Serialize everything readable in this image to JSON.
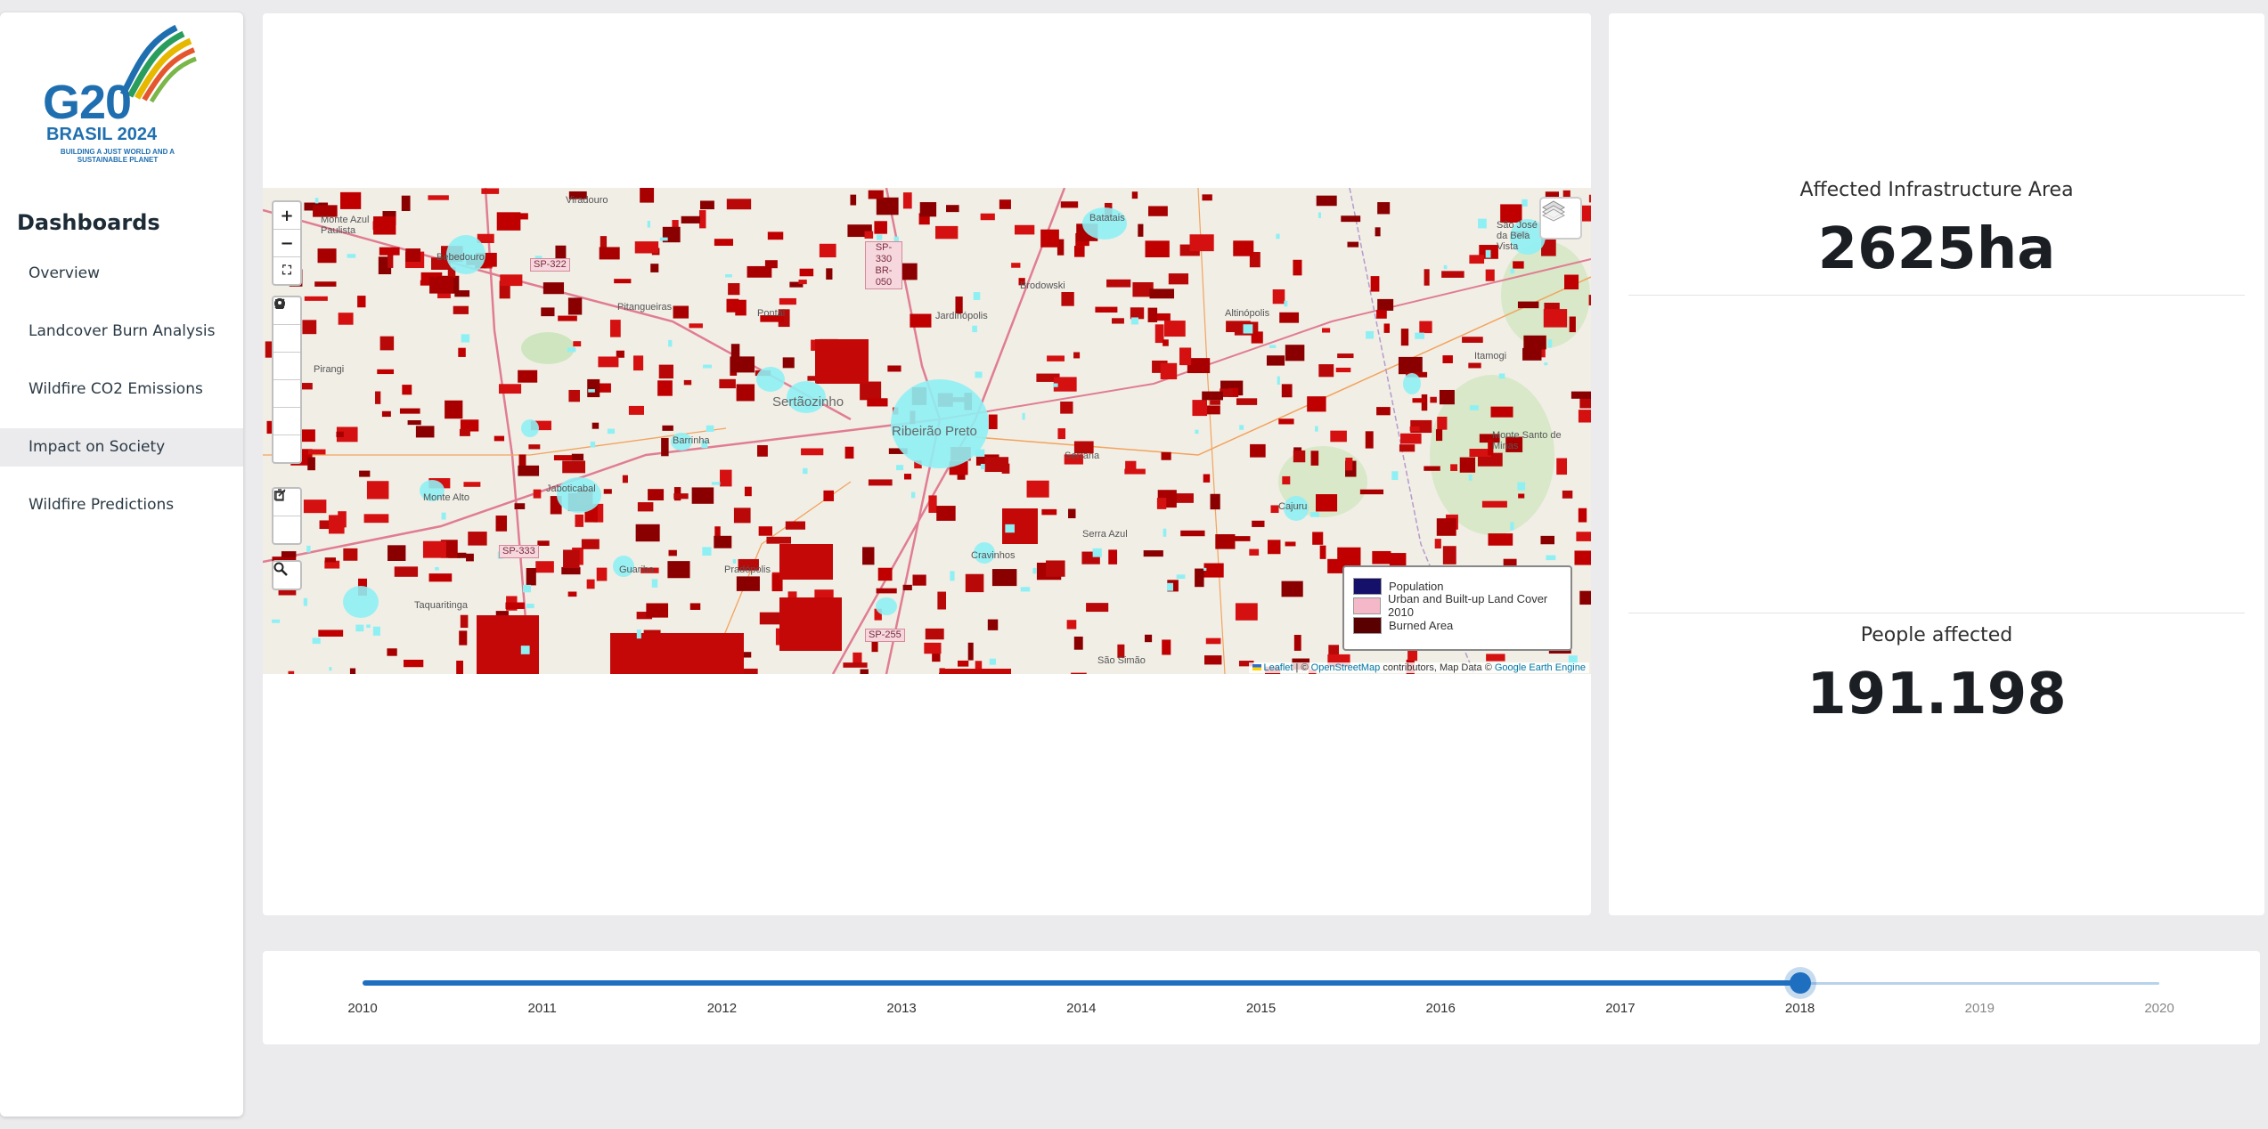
{
  "sidebar": {
    "logo": {
      "g20": "G20",
      "brasil": "BRASIL 2024",
      "tagline": "BUILDING A JUST WORLD AND A SUSTAINABLE PLANET"
    },
    "title": "Dashboards",
    "items": [
      {
        "label": "Overview",
        "active": false
      },
      {
        "label": "Landcover Burn Analysis",
        "active": false
      },
      {
        "label": "Wildfire CO2 Emissions",
        "active": false
      },
      {
        "label": "Impact on Society",
        "active": true
      },
      {
        "label": "Wildfire Predictions",
        "active": false
      }
    ]
  },
  "map": {
    "controls": {
      "zoom_in": "+",
      "zoom_out": "−",
      "fullscreen": "⛶",
      "search": "🔍"
    },
    "roads": [
      "SP-322",
      "SP-330 BR-050",
      "SP-333",
      "SP-255"
    ],
    "towns": [
      "Monte Azul Paulista",
      "Bebedouro",
      "Viradouro",
      "Pitangueiras",
      "Pontal",
      "Jardinópolis",
      "Brodowski",
      "Batatais",
      "Altinópolis",
      "São José da Bela Vista",
      "Pirangi",
      "Sertãozinho",
      "Ribeirão Preto",
      "Barrinha",
      "Serrana",
      "Itamogi",
      "Monte Alto",
      "Jaboticabal",
      "Monte Santo de Minas",
      "Cajuru",
      "Cravinhos",
      "Serra Azul",
      "Guariba",
      "Pradópolis",
      "Taquaritinga",
      "São Simão"
    ],
    "legend": [
      {
        "label": "Population",
        "color": "#15106a"
      },
      {
        "label": "Urban and Built-up Land Cover 2010",
        "color": "#f4b8c8"
      },
      {
        "label": "Burned Area",
        "color": "#5a0000"
      }
    ],
    "attribution": {
      "leaflet": "Leaflet",
      "sep": "| ©",
      "osm": "OpenStreetMap",
      "mid": "contributors, Map Data ©",
      "gee": "Google Earth Engine"
    }
  },
  "stats": {
    "infrastructure": {
      "label": "Affected Infrastructure Area",
      "value": "2625ha"
    },
    "people": {
      "label": "People affected",
      "value": "191.198"
    }
  },
  "timeline": {
    "years": [
      "2010",
      "2011",
      "2012",
      "2013",
      "2014",
      "2015",
      "2016",
      "2017",
      "2018",
      "2019",
      "2020"
    ],
    "selected_index": 8
  }
}
